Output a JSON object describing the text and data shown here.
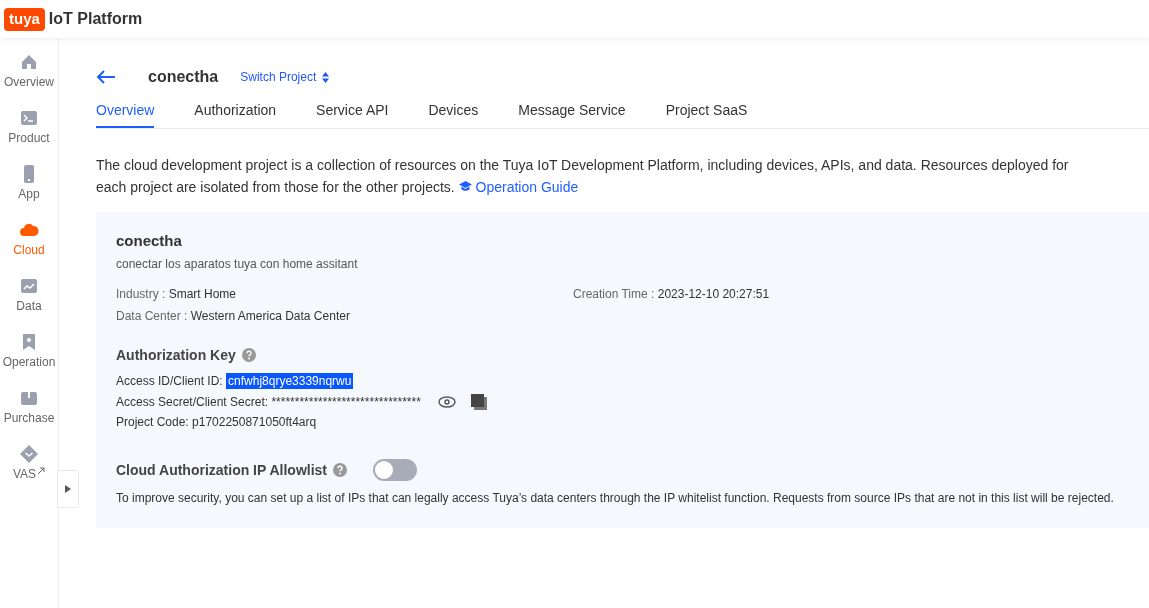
{
  "header": {
    "logo": "tuya",
    "title": "IoT Platform"
  },
  "sidebar": {
    "items": [
      {
        "label": "Overview",
        "kind": "home",
        "selected": false
      },
      {
        "label": "Product",
        "kind": "terminal",
        "selected": false
      },
      {
        "label": "App",
        "kind": "phone",
        "selected": false
      },
      {
        "label": "Cloud",
        "kind": "cloud",
        "selected": true
      },
      {
        "label": "Data",
        "kind": "chart",
        "selected": false
      },
      {
        "label": "Operation",
        "kind": "bookmark",
        "selected": false
      },
      {
        "label": "Purchase",
        "kind": "box",
        "selected": false
      },
      {
        "label": "VAS",
        "kind": "diamond",
        "selected": false,
        "external": true
      }
    ]
  },
  "project": {
    "name": "conectha",
    "switch": "Switch Project"
  },
  "tabs": [
    {
      "label": "Overview",
      "selected": true
    },
    {
      "label": "Authorization",
      "selected": false
    },
    {
      "label": "Service API",
      "selected": false
    },
    {
      "label": "Devices",
      "selected": false
    },
    {
      "label": "Message Service",
      "selected": false
    },
    {
      "label": "Project SaaS",
      "selected": false
    }
  ],
  "intro": {
    "text": "The cloud development project is a collection of resources on the Tuya IoT Development Platform, including devices, APIs, and data. Resources deployed for each project are isolated from those for the other projects.",
    "link": "Operation Guide"
  },
  "card": {
    "name": "conectha",
    "description": "conectar los aparatos tuya con home assitant",
    "details": [
      {
        "label": "Industry : ",
        "value": "Smart Home"
      },
      {
        "label": "Data Center : ",
        "value": "Western America Data Center"
      },
      {
        "label": "Creation Time : ",
        "value": "2023-12-10 20:27:51"
      }
    ],
    "auth_key": {
      "title": "Authorization Key",
      "access_id": {
        "label": "Access ID/Client ID: ",
        "value": "cnfwhj8qrye3339nqrwu",
        "highlighted": true
      },
      "access_secret": {
        "label": "Access Secret/Client Secret: ",
        "value": "********************************"
      },
      "project_code": {
        "label": "Project Code: ",
        "value": "p1702250871050ft4arq"
      }
    },
    "allowlist": {
      "title": "Cloud Authorization IP Allowlist",
      "on": false,
      "note": "To improve security, you can set up a list of IPs that can legally access Tuya’s data centers through the IP whitelist function. Requests from source IPs that are not in this list will be rejected."
    }
  }
}
